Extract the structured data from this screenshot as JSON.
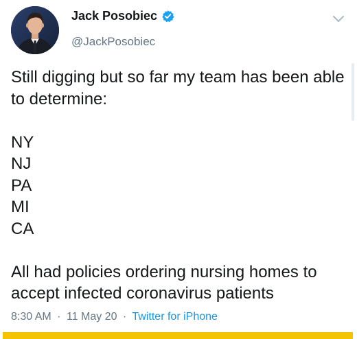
{
  "tweet": {
    "author": {
      "display_name": "Jack Posobiec",
      "handle": "@JackPosobiec",
      "verified": true
    },
    "body": {
      "intro": "Still digging but so far my team has been able to determine:",
      "states": [
        "NY",
        "NJ",
        "PA",
        "MI",
        "CA"
      ],
      "outro": "All had policies ordering nursing homes to accept infected coronavirus patients"
    },
    "meta": {
      "time": "8:30 AM",
      "separator": "·",
      "date": "11 May 20",
      "source": "Twitter for iPhone"
    }
  },
  "icons": {
    "verified": "verified-badge-icon",
    "more": "chevron-down-icon"
  },
  "colors": {
    "text": "#14171a",
    "secondary": "#657786",
    "link": "#1b95e0",
    "verified": "#1da1f2",
    "highlight_bar": "#f5c400"
  }
}
